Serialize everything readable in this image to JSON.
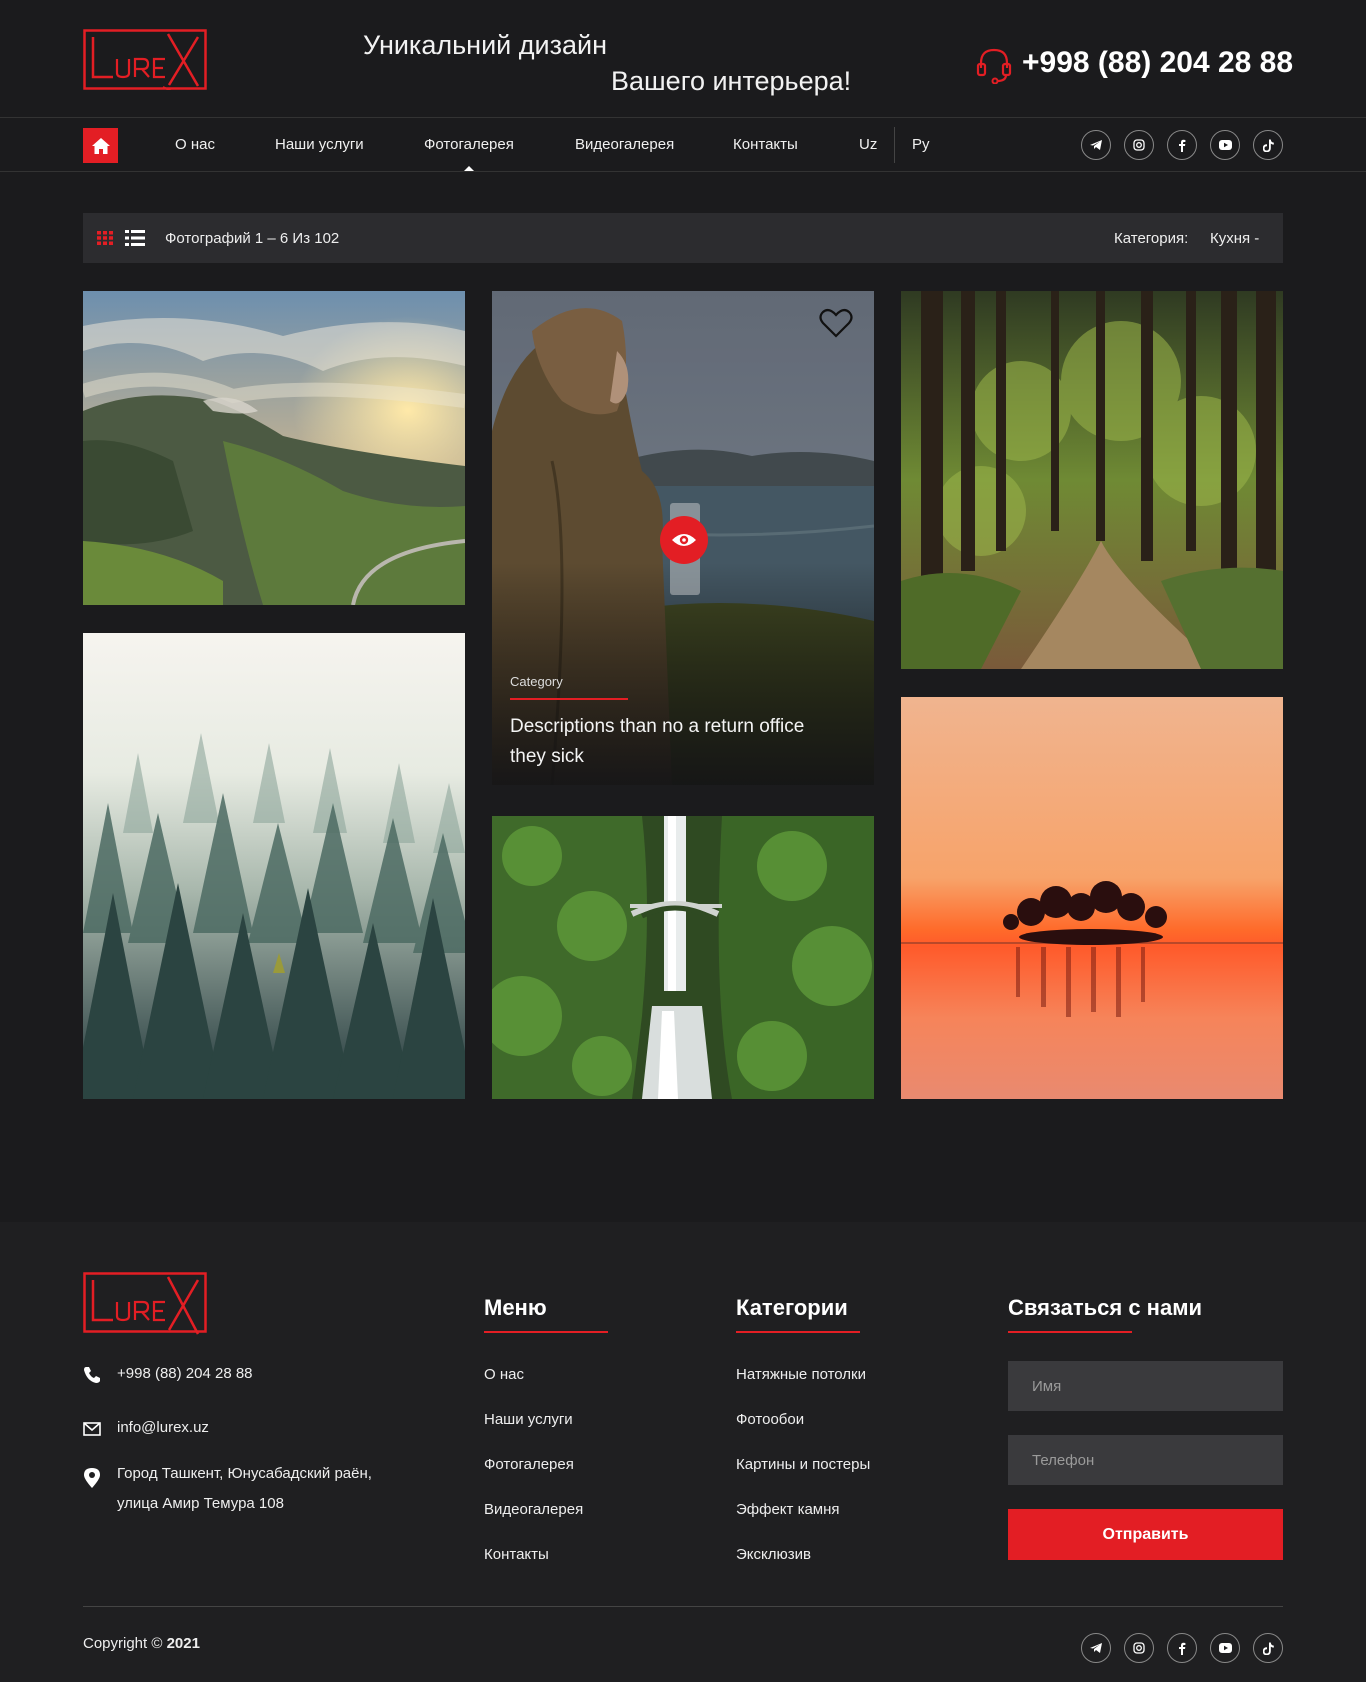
{
  "header": {
    "logo_text": "LUREX",
    "tagline_line1": "Уникальний дизайн",
    "tagline_line2": "Вашего интерьера!",
    "phone": "+998 (88) 204 28 88"
  },
  "nav": {
    "items": [
      {
        "label": "О нас"
      },
      {
        "label": "Наши услуги"
      },
      {
        "label": "Фотогалерея"
      },
      {
        "label": "Видеогалерея"
      },
      {
        "label": "Контакты"
      },
      {
        "label": "Uz"
      },
      {
        "label": "Ру"
      }
    ],
    "active": "Фотогалерея",
    "socials": [
      "telegram-icon",
      "instagram-icon",
      "facebook-icon",
      "youtube-icon",
      "tiktok-icon"
    ]
  },
  "toolbar": {
    "count_text": "Фотографий 1 – 6 Из 102",
    "category_label": "Категория:",
    "category_value": "Кухня -"
  },
  "gallery": {
    "featured": {
      "category": "Category",
      "description": "Descriptions than no a return office they sick"
    }
  },
  "footer": {
    "phone": "+998 (88) 204 28 88",
    "email": "info@lurex.uz",
    "address_line1": "Город Ташкент, Юнусабадский раён,",
    "address_line2": "улица Амир Темура 108",
    "menu_heading": "Меню",
    "menu": [
      "О нас",
      "Наши услуги",
      "Фотогалерея",
      "Видеогалерея",
      "Контакты"
    ],
    "categories_heading": "Категории",
    "categories": [
      "Натяжные потолки",
      "Фотообои",
      "Картины и постеры",
      "Эффект камня",
      "Эксклюзив"
    ],
    "contact_heading": "Связаться с нами",
    "name_placeholder": "Имя",
    "phone_placeholder": "Телефон",
    "submit_label": "Отправить",
    "copyright_prefix": "Copyright ©",
    "copyright_year": "2021"
  },
  "colors": {
    "accent": "#e31e24",
    "background": "#1b1b1d",
    "panel": "#2c2c2f"
  }
}
